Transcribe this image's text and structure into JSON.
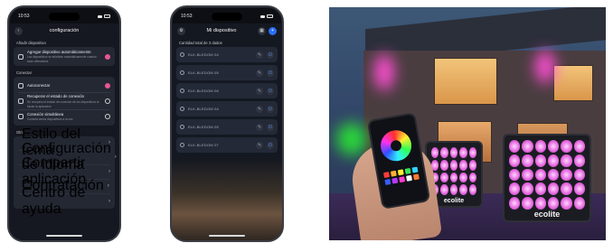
{
  "colors": {
    "accent": "#e8568e",
    "blue": "#2b6ef2",
    "panel": "#232833"
  },
  "phone1": {
    "time": "10:53",
    "header": {
      "back_icon": "back-arrow-icon",
      "title": "configuración"
    },
    "sections": [
      {
        "label": "Añadir dispositivo",
        "rows": [
          {
            "icon": "plus-device-icon",
            "title": "Agregar dispositivo automáticamente",
            "sub": "Los dispositivos se añadirán automáticamente cuando sean detectados",
            "control": "toggle"
          }
        ]
      },
      {
        "label": "Conectar",
        "rows": [
          {
            "icon": "link-icon",
            "title": "Autoconectar",
            "sub": "",
            "control": "toggle"
          },
          {
            "icon": "refresh-icon",
            "title": "Recuperar el estado de conexión",
            "sub": "Se recupera el estado de conexión de los dispositivos al iniciar la aplicación",
            "control": "spinner"
          },
          {
            "icon": "sync-icon",
            "title": "Conexión simultánea",
            "sub": "Conecta varios dispositivos a la vez",
            "control": "spinner"
          }
        ]
      },
      {
        "label": "Otro",
        "rows": [
          {
            "icon": "theme-icon",
            "title": "Estilo del tema",
            "control": "chevron"
          },
          {
            "icon": "globe-icon",
            "title": "Configuración de idioma",
            "control": "chevron"
          },
          {
            "icon": "share-icon",
            "title": "Compartir aplicación",
            "control": "chevron"
          },
          {
            "icon": "document-icon",
            "title": "Contratación",
            "control": "chevron"
          },
          {
            "icon": "help-icon",
            "title": "Centro de ayuda",
            "control": "chevron"
          }
        ]
      }
    ]
  },
  "phone2": {
    "time": "10:53",
    "header": {
      "title": "Mi dispositivo"
    },
    "total_label": "Cantidad total de 3 dados",
    "devices": [
      {
        "name": "ELK-BLEDOM 04"
      },
      {
        "name": "ELK-BLEDOM 05"
      },
      {
        "name": "ELK-BLEDOM 06"
      },
      {
        "name": "ELK-BLEDOM 04"
      },
      {
        "name": "ELK-BLEDOM 05"
      },
      {
        "name": "ELK-BLEDOM 07"
      }
    ]
  },
  "photo": {
    "brand_1": "ecolite",
    "brand_2": "ecolite",
    "swatches": [
      "#ff3b3b",
      "#ffb030",
      "#ffee30",
      "#35e35a",
      "#30d5ff",
      "#3a5bff",
      "#b43bff",
      "#ff3bd1",
      "#ffffff",
      "#ff7a30"
    ]
  }
}
